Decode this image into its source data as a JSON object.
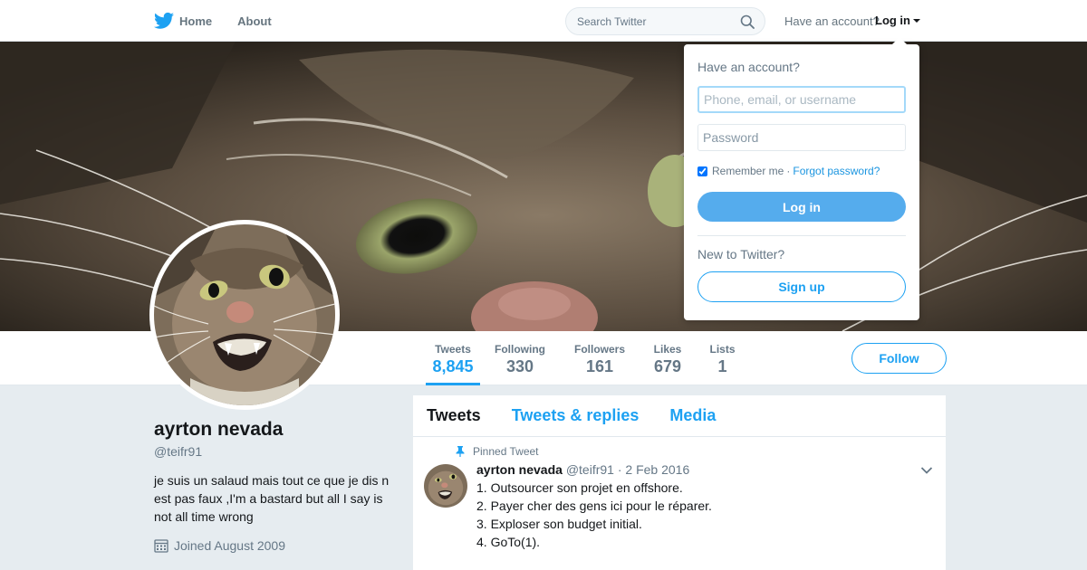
{
  "colors": {
    "brand": "#1da1f2",
    "login_button": "#55aced",
    "muted": "#657786",
    "background": "#e6ecf0"
  },
  "nav": {
    "home_label": "Home",
    "about_label": "About",
    "search_placeholder": "Search Twitter",
    "account_prompt": "Have an account?",
    "login_label": "Log in"
  },
  "icons": {
    "logo": "twitter-bird-icon",
    "search": "search-icon",
    "caret": "caret-down-icon",
    "pin": "pin-icon",
    "calendar": "calendar-icon",
    "chevron": "chevron-down-icon"
  },
  "stats": [
    {
      "label": "Tweets",
      "value": "8,845",
      "active": true
    },
    {
      "label": "Following",
      "value": "330"
    },
    {
      "label": "Followers",
      "value": "161"
    },
    {
      "label": "Likes",
      "value": "679"
    },
    {
      "label": "Lists",
      "value": "1"
    }
  ],
  "follow_label": "Follow",
  "profile": {
    "name": "ayrton nevada",
    "handle": "@teifr91",
    "bio": "je suis un salaud mais tout ce que je dis n est pas faux ,I'm a bastard but all I say is not all time wrong",
    "joined": "Joined August 2009"
  },
  "timeline": {
    "tabs": [
      "Tweets",
      "Tweets & replies",
      "Media"
    ],
    "pinned_label": "Pinned Tweet",
    "tweet": {
      "name": "ayrton nevada",
      "meta": "@teifr91 · 2 Feb 2016",
      "lines": [
        "1. Outsourcer son projet en offshore.",
        "2. Payer cher des gens ici pour le réparer.",
        "3. Exploser son budget initial.",
        "4. GoTo(1)."
      ]
    }
  },
  "login_dropdown": {
    "title": "Have an account?",
    "username_placeholder": "Phone, email, or username",
    "password_placeholder": "Password",
    "remember_label": "Remember me",
    "separator": "·",
    "forgot_label": "Forgot password?",
    "login_button": "Log in",
    "new_prompt": "New to Twitter?",
    "signup_button": "Sign up"
  }
}
